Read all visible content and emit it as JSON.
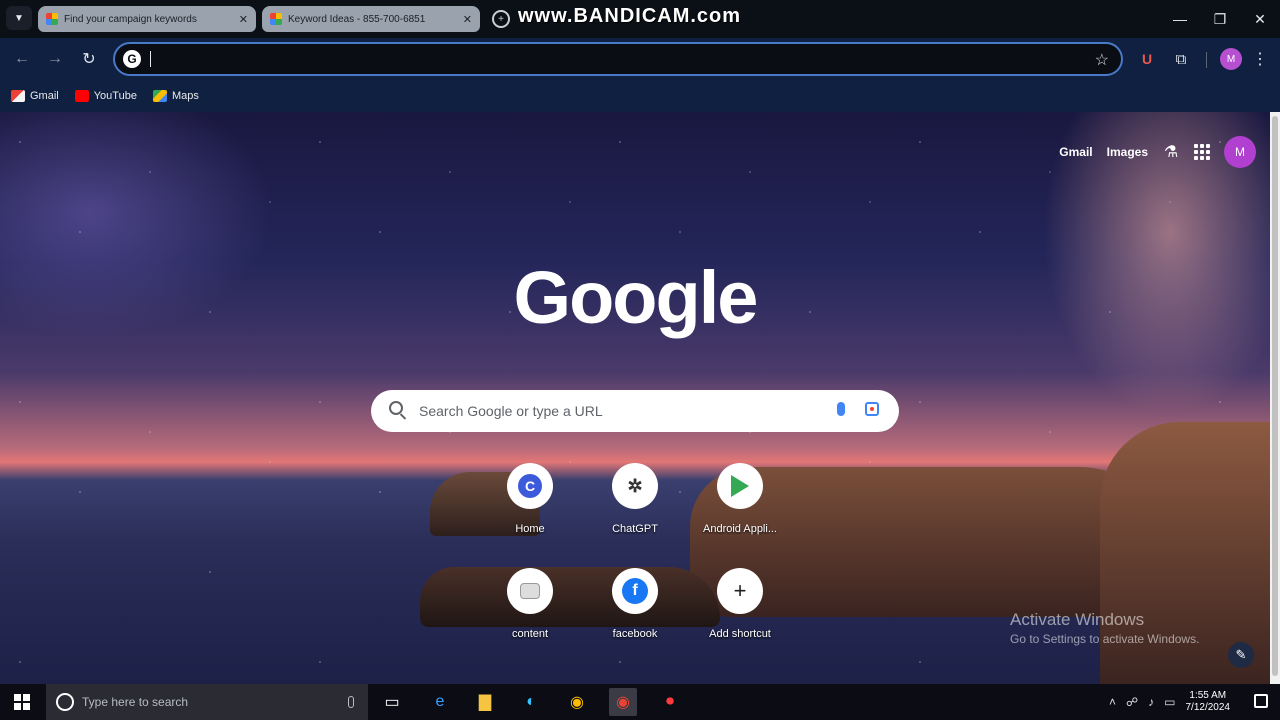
{
  "browser": {
    "tabs": [
      {
        "title": "Find your campaign keywords"
      },
      {
        "title": "Keyword Ideas - 855-700-6851"
      }
    ],
    "watermark": "www.BANDICAM.com",
    "new_tab_label": "+",
    "omnibox": {
      "value": ""
    },
    "bookmarks": [
      {
        "label": "Gmail",
        "icon": "gmail-icon"
      },
      {
        "label": "YouTube",
        "icon": "youtube-icon"
      },
      {
        "label": "Maps",
        "icon": "maps-icon"
      }
    ],
    "profile_initial": "M"
  },
  "ntp": {
    "top_links": {
      "gmail": "Gmail",
      "images": "Images"
    },
    "avatar_initial": "M",
    "logo": "Google",
    "search_placeholder": "Search Google or type a URL",
    "shortcuts": [
      {
        "label": "Home",
        "icon": "home-c-icon"
      },
      {
        "label": "ChatGPT",
        "icon": "chatgpt-icon"
      },
      {
        "label": "Android Appli...",
        "icon": "google-play-icon"
      },
      {
        "label": "content",
        "icon": "content-icon"
      },
      {
        "label": "facebook",
        "icon": "facebook-icon"
      },
      {
        "label": "Add shortcut",
        "icon": "plus-icon"
      }
    ],
    "activate_line1": "Activate Windows",
    "activate_line2": "Go to Settings to activate Windows."
  },
  "taskbar": {
    "search_placeholder": "Type here to search",
    "time": "1:55 AM",
    "date": "7/12/2024"
  },
  "colors": {
    "accent": "#4a79c8",
    "profile": "#b13fcf",
    "toolbar": "#0f2040"
  }
}
